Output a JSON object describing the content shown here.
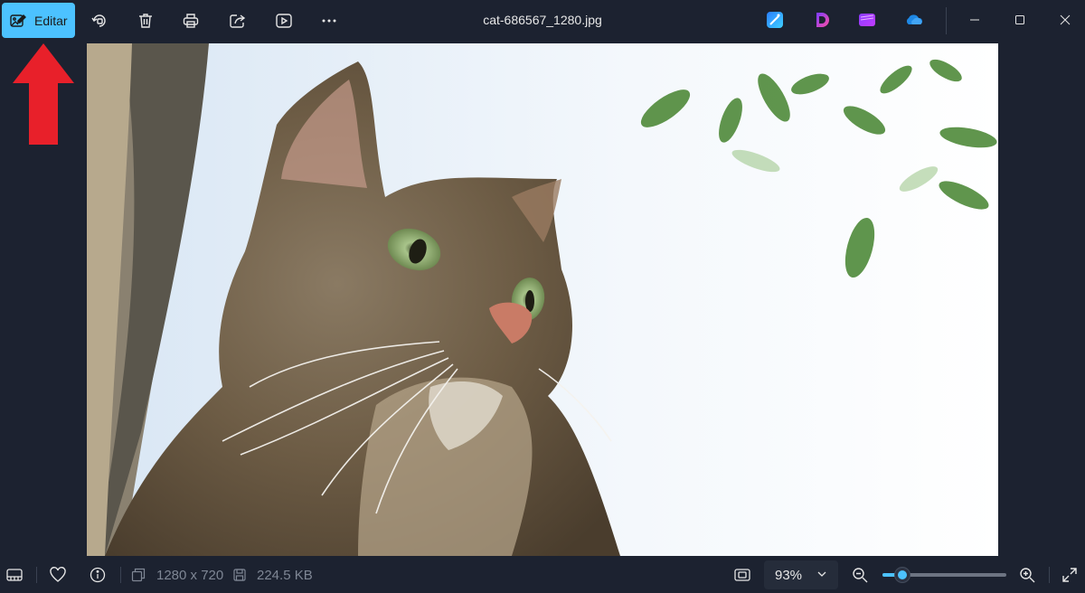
{
  "toolbar": {
    "edit_label": "Editar",
    "icons": [
      "edit-image-icon",
      "rotate-icon",
      "delete-icon",
      "print-icon",
      "share-icon",
      "slideshow-icon",
      "more-icon"
    ]
  },
  "window": {
    "title": "cat-686567_1280.jpg",
    "apps": [
      "designer-icon",
      "clipchamp-like-icon",
      "clipchamp-icon",
      "onedrive-icon"
    ],
    "controls": [
      "minimize-icon",
      "maximize-icon",
      "close-icon"
    ]
  },
  "image": {
    "subject": "cat-photo"
  },
  "statusbar": {
    "dimensions": "1280 x 720",
    "file_size": "224.5 KB",
    "zoom_label": "93%",
    "zoom_value": 0.16
  },
  "colors": {
    "accent": "#4cc2ff",
    "background": "#1c2230",
    "arrow": "#e8202a"
  }
}
